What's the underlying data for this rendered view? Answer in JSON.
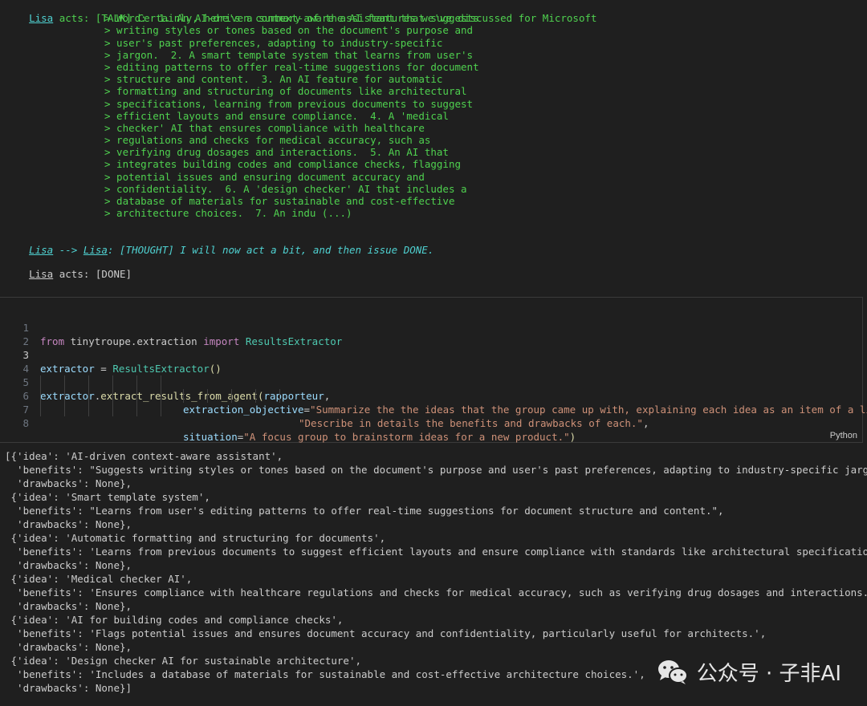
{
  "talk": {
    "speaker": "Lisa",
    "prefix": " acts: [TALK] ",
    "lines": [
      "Certainly, here's a summary of the AI features we've discussed for Microsoft",
      "> Word:  1. An AI-driven context-aware assistant that suggests",
      "> writing styles or tones based on the document's purpose and",
      "> user's past preferences, adapting to industry-specific",
      "> jargon.  2. A smart template system that learns from user's",
      "> editing patterns to offer real-time suggestions for document",
      "> structure and content.  3. An AI feature for automatic",
      "> formatting and structuring of documents like architectural",
      "> specifications, learning from previous documents to suggest",
      "> efficient layouts and ensure compliance.  4. A 'medical",
      "> checker' AI that ensures compliance with healthcare",
      "> regulations and checks for medical accuracy, such as",
      "> verifying drug dosages and interactions.  5. An AI that",
      "> integrates building codes and compliance checks, flagging",
      "> potential issues and ensuring document accuracy and",
      "> confidentiality.  6. A 'design checker' AI that includes a",
      "> database of materials for sustainable and cost-effective",
      "> architecture choices.  7. An indu (...)"
    ]
  },
  "thought": {
    "from": "Lisa",
    "arrow": " --> ",
    "to": "Lisa",
    "text": ": [THOUGHT] I will now act a bit, and then issue DONE."
  },
  "done": {
    "speaker": "Lisa",
    "text": " acts: [DONE]"
  },
  "code_cell": {
    "line_numbers": [
      "1",
      "2",
      "3",
      "4",
      "5",
      "6",
      "7",
      "8"
    ],
    "language": "Python",
    "l1": {
      "kw1": "from",
      "mod": " tinytroupe.extraction ",
      "kw2": "import",
      "cls": " ResultsExtractor"
    },
    "l3": {
      "var": "extractor",
      "op": " = ",
      "cls": "ResultsExtractor",
      "paren": "()"
    },
    "l5": {
      "var": "extractor",
      "dot": ".",
      "fn": "extract_results_from_agent",
      "open": "(",
      "arg": "rapporteur",
      "comma": ","
    },
    "l6": {
      "param": "extraction_objective",
      "eq": "=",
      "str": "\"Summarize the the ideas that the group came up with, explaining each idea as an item of a list.\"",
      "cont": " \\"
    },
    "l7": {
      "str": "\"Describe in details the benefits and drawbacks of each.\"",
      "comma": ","
    },
    "l8": {
      "param": "situation",
      "eq": "=",
      "str": "\"A focus group to brainstorm ideas for a new product.\"",
      "close": ")"
    }
  },
  "result_lines": [
    "[{'idea': 'AI-driven context-aware assistant',",
    "  'benefits': \"Suggests writing styles or tones based on the document's purpose and user's past preferences, adapting to industry-specific jargon.\",",
    "  'drawbacks': None},",
    " {'idea': 'Smart template system',",
    "  'benefits': \"Learns from user's editing patterns to offer real-time suggestions for document structure and content.\",",
    "  'drawbacks': None},",
    " {'idea': 'Automatic formatting and structuring for documents',",
    "  'benefits': 'Learns from previous documents to suggest efficient layouts and ensure compliance with standards like architectural specifications.',",
    "  'drawbacks': None},",
    " {'idea': 'Medical checker AI',",
    "  'benefits': 'Ensures compliance with healthcare regulations and checks for medical accuracy, such as verifying drug dosages and interactions.',",
    "  'drawbacks': None},",
    " {'idea': 'AI for building codes and compliance checks',",
    "  'benefits': 'Flags potential issues and ensures document accuracy and confidentiality, particularly useful for architects.',",
    "  'drawbacks': None},",
    " {'idea': 'Design checker AI for sustainable architecture',",
    "  'benefits': 'Includes a database of materials for sustainable and cost-effective architecture choices.',",
    "  'drawbacks': None}]"
  ],
  "watermark": {
    "text": "公众号 · 子非AI",
    "icon": "wechat-icon"
  }
}
